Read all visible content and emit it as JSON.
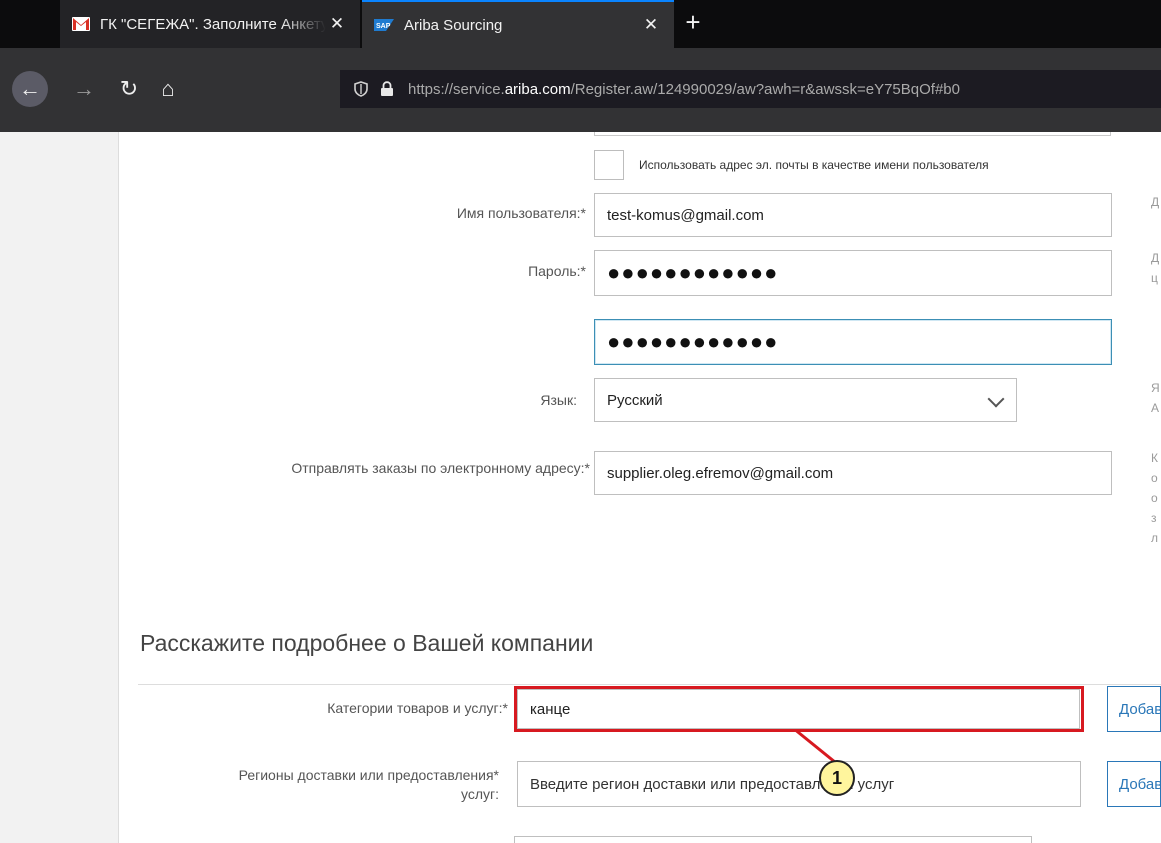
{
  "browser": {
    "tabs": [
      {
        "title": "ГК \"СЕГЕЖА\". Заполните Анкету",
        "close": "✕",
        "icon": "gmail-icon"
      },
      {
        "title": "Ariba Sourcing",
        "close": "✕",
        "icon": "sap-icon",
        "active": true
      }
    ],
    "new_tab": "+",
    "nav": {
      "back": "←",
      "forward": "→",
      "reload": "↻",
      "home": "⌂"
    },
    "url": {
      "prefix": "https://service.",
      "domain": "ariba.com",
      "path": "/Register.aw/124990029/aw?awh=r&awssk=eY75BqOf#b0"
    },
    "sap_logo_text": "SAP"
  },
  "form": {
    "use_email_checkbox_label": "Использовать адрес эл. почты в качестве имени пользователя",
    "username": {
      "label": "Имя пользователя:*",
      "value": "test-komus@gmail.com"
    },
    "password": {
      "label": "Пароль:*",
      "value": "●●●●●●●●●●●●"
    },
    "password_confirm": {
      "value": "●●●●●●●●●●●●"
    },
    "language": {
      "label": "Язык:",
      "value": "Русский"
    },
    "order_email": {
      "label": "Отправлять заказы по электронному адресу:*",
      "value": "supplier.oleg.efremov@gmail.com"
    },
    "section_title": "Расскажите подробнее о Вашей компании",
    "categories": {
      "label": "Категории товаров и услуг:*",
      "value": "канце",
      "add_button": "Добавить"
    },
    "regions": {
      "label_line1": "Регионы доставки или предоставления*",
      "label_line2": "услуг:",
      "placeholder": "Введите регион доставки или предоставления услуг",
      "add_button": "Добавить"
    }
  },
  "help_fragments": [
    [
      "Д"
    ],
    [
      "Д",
      "ц"
    ],
    [
      "Я",
      "А"
    ],
    [
      "К",
      "о",
      "о",
      "з",
      "л"
    ]
  ],
  "callout_number": "1",
  "colors": {
    "highlight": "#d71920",
    "link": "#2a77b8",
    "badge": "#fff59d",
    "tab_accent": "#0a84ff"
  }
}
